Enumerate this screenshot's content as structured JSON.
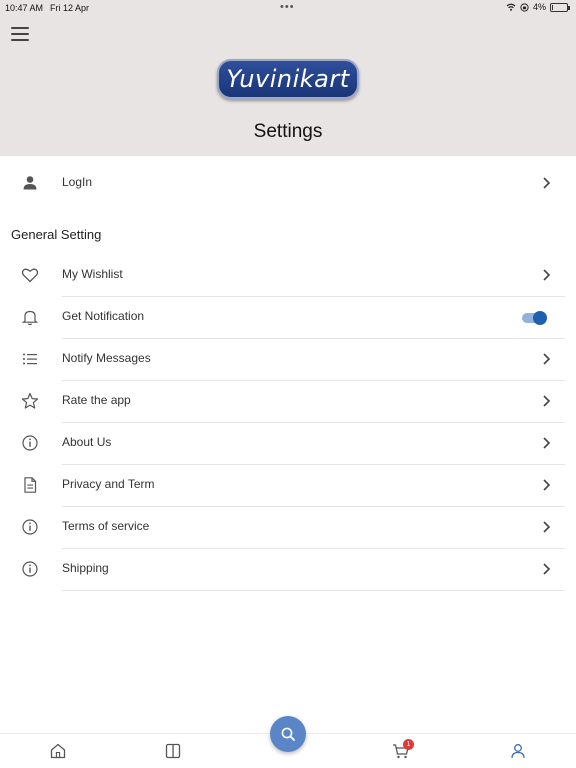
{
  "status_bar": {
    "time": "10:47 AM",
    "date": "Fri 12 Apr",
    "battery": "4%",
    "battery_level": 0.04
  },
  "header": {
    "logo_text": "Yuvinikart",
    "title": "Settings"
  },
  "account": {
    "login_label": "LogIn"
  },
  "general": {
    "section_title": "General Setting",
    "items": [
      {
        "label": "My Wishlist",
        "icon": "heart-icon"
      },
      {
        "label": "Get Notification",
        "icon": "bell-icon",
        "toggle_on": true
      },
      {
        "label": "Notify Messages",
        "icon": "list-icon"
      },
      {
        "label": "Rate the app",
        "icon": "star-icon"
      },
      {
        "label": "About Us",
        "icon": "info-icon"
      },
      {
        "label": "Privacy and Term",
        "icon": "document-icon"
      },
      {
        "label": "Terms of service",
        "icon": "info-icon"
      },
      {
        "label": "Shipping",
        "icon": "info-icon"
      }
    ]
  },
  "tabbar": {
    "items": [
      "home-icon",
      "catalog-icon",
      "search-icon",
      "cart-icon",
      "profile-icon"
    ],
    "cart_badge": "1"
  },
  "colors": {
    "header_bg": "#e8e4e3",
    "accent": "#1f5fb0",
    "fab": "#5a86c8",
    "badge": "#e53935"
  }
}
